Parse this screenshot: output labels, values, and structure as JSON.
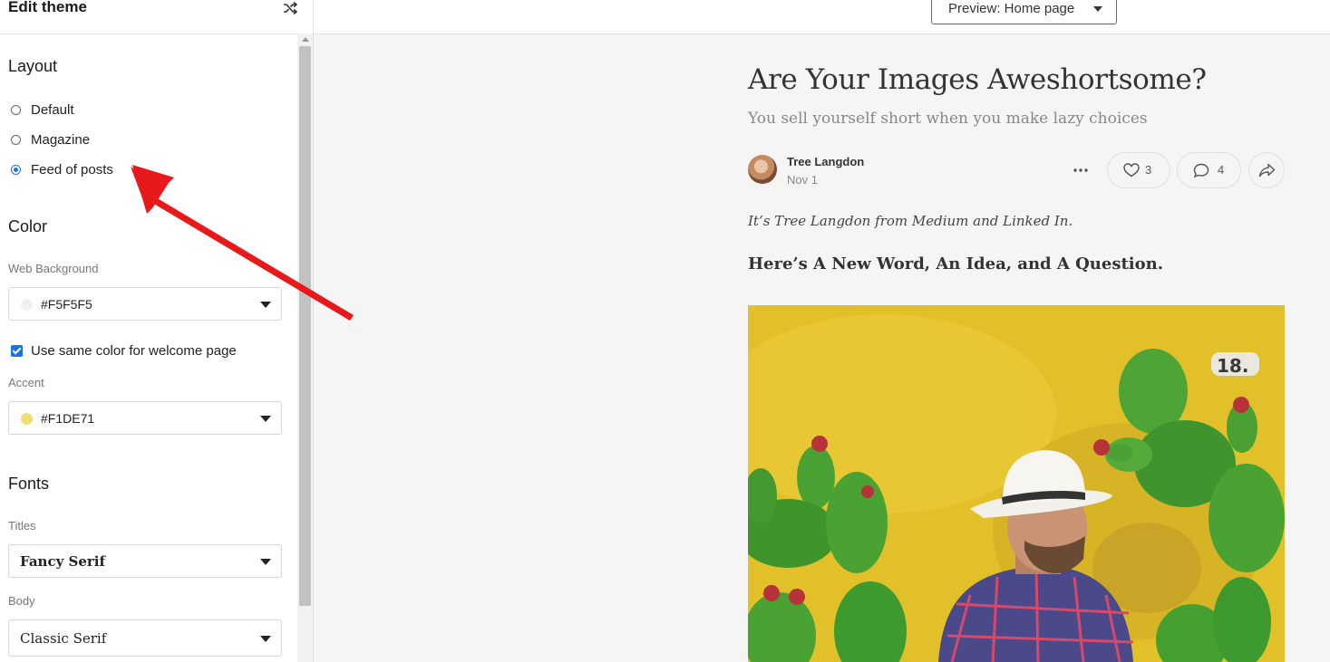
{
  "sidebar": {
    "title": "Edit theme",
    "layout": {
      "heading": "Layout",
      "options": [
        {
          "label": "Default",
          "selected": false
        },
        {
          "label": "Magazine",
          "selected": false
        },
        {
          "label": "Feed of posts",
          "selected": true
        }
      ]
    },
    "color": {
      "heading": "Color",
      "web_background": {
        "label": "Web Background",
        "value": "#F5F5F5",
        "swatch": "#F5F5F5"
      },
      "same_color_checkbox": {
        "label": "Use same color for welcome page",
        "checked": true
      },
      "accent": {
        "label": "Accent",
        "value": "#F1DE71",
        "swatch": "#F1DE71"
      }
    },
    "fonts": {
      "heading": "Fonts",
      "titles": {
        "label": "Titles",
        "value": "Fancy Serif"
      },
      "body": {
        "label": "Body",
        "value": "Classic Serif"
      }
    }
  },
  "topbar": {
    "preview_select": "Preview: Home page"
  },
  "post": {
    "title": "Are Your Images Aweshortsome?",
    "subtitle": "You sell yourself short when you make lazy choices",
    "author": "Tree Langdon",
    "date": "Nov 1",
    "likes": "3",
    "comments": "4",
    "intro": "It’s Tree Langdon from Medium and Linked In.",
    "heading": "Here’s A New Word, An Idea, and A Question.",
    "image_number": "18."
  },
  "colors": {
    "accent_blue": "#1A73E8",
    "arrow_red": "#E8191B"
  },
  "icons": [
    "shuffle-icon",
    "heart-icon",
    "comment-icon",
    "share-icon",
    "more-icon",
    "caret-down-icon"
  ]
}
